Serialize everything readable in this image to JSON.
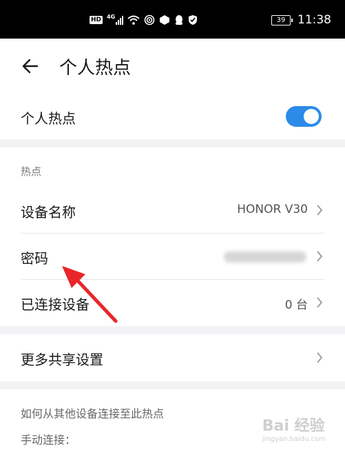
{
  "status_bar": {
    "time": "11:38",
    "battery": "39",
    "hd": "HD",
    "network": "4G"
  },
  "header": {
    "title": "个人热点"
  },
  "hotspot_toggle": {
    "label": "个人热点",
    "enabled": true,
    "on_color": "#2c8ae8"
  },
  "section_hotspot": {
    "title": "热点"
  },
  "device_name": {
    "label": "设备名称",
    "value": "HONOR V30"
  },
  "password": {
    "label": "密码"
  },
  "connected": {
    "label": "已连接设备",
    "value": "0 台"
  },
  "more": {
    "label": "更多共享设置"
  },
  "help": {
    "title": "如何从其他设备连接至此热点",
    "manual": "手动连接："
  },
  "watermark": {
    "text": "Bai 经验",
    "sub": "jingyan.baidu.com"
  },
  "colors": {
    "annotation_arrow": "#e8262a",
    "gap_background": "#f1f3f5"
  }
}
